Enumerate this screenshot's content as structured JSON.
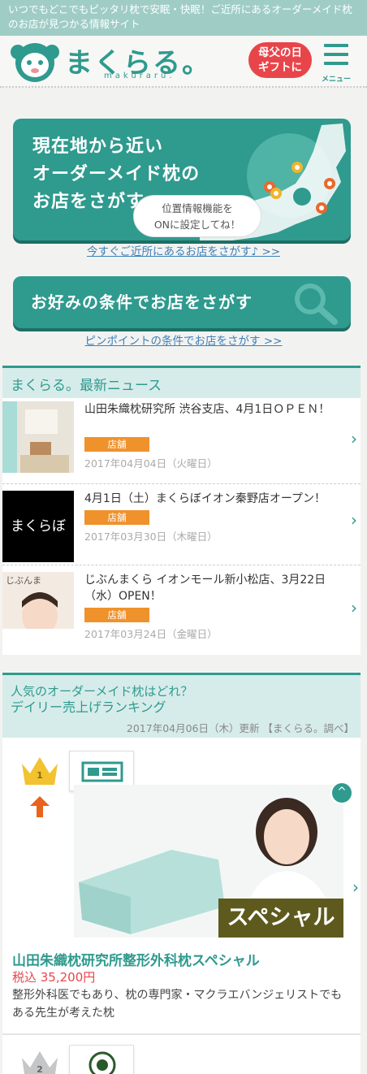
{
  "topbar": {
    "text": "いつでもどこでもピッタリ枕で安眠・快眠！ご近所にあるオーダーメイド枕のお店が見つかる情報サイト"
  },
  "header": {
    "logo_text": "まくらる。",
    "logo_sub": "makuraru.",
    "gift_badge_line1": "母父の日",
    "gift_badge_line2": "ギフトに",
    "menu_label": "メニュー"
  },
  "search_near": {
    "title_line1": "現在地から近い",
    "title_line2": "オーダーメイド枕の",
    "title_line3": "お店をさがす",
    "bubble_line1": "位置情報機能を",
    "bubble_line2": "ONに設定してね！",
    "link": "今すぐご近所にあるお店をさがす♪ >>"
  },
  "search_condition": {
    "title": "お好みの条件でお店をさがす",
    "link": "ピンポイントの条件でお店をさがす >>"
  },
  "news": {
    "heading": "まくらる。最新ニュース",
    "items": [
      {
        "title": "山田朱織枕研究所 渋谷支店、4月1日ＯＰＥＮ！",
        "tag": "店舗",
        "date": "2017年04月04日（火曜日）"
      },
      {
        "title": "4月1日（土）まくらぼイオン秦野店オープン！",
        "tag": "店舗",
        "date": "2017年03月30日（木曜日）"
      },
      {
        "title": "じぶんまくら イオンモール新小松店、3月22日（水）OPEN！",
        "tag": "店舗",
        "date": "2017年03月24日（金曜日）"
      }
    ],
    "thumb2_text": "まくらぼ",
    "thumb3_text": "じぶんま"
  },
  "ranking": {
    "heading_line1": "人気のオーダーメイド枕はどれ？",
    "heading_line2": "デイリー売上げランキング",
    "updated": "2017年04月06日（木）更新 【まくらる。調べ】",
    "items": [
      {
        "rank": "1",
        "badge": "スペシャル",
        "name": "山田朱織枕研究所整形外科枕スペシャル",
        "price": "税込 35,200円",
        "desc": "整形外科医でもあり、枕の専門家・マクラエバンジェリストでもある先生が考えた枕"
      },
      {
        "rank": "2"
      }
    ]
  },
  "colors": {
    "accent": "#2f9a8e",
    "topbar": "#9fcdc6",
    "price": "#e8454a",
    "tag": "#f0922c",
    "link": "#3e7fb8"
  },
  "icons": [
    "mascot-logo",
    "menu-icon",
    "map-pin-icon",
    "magnifier-icon",
    "chevron-right-icon",
    "crown-icon",
    "arrow-up-icon",
    "scroll-top-icon"
  ]
}
